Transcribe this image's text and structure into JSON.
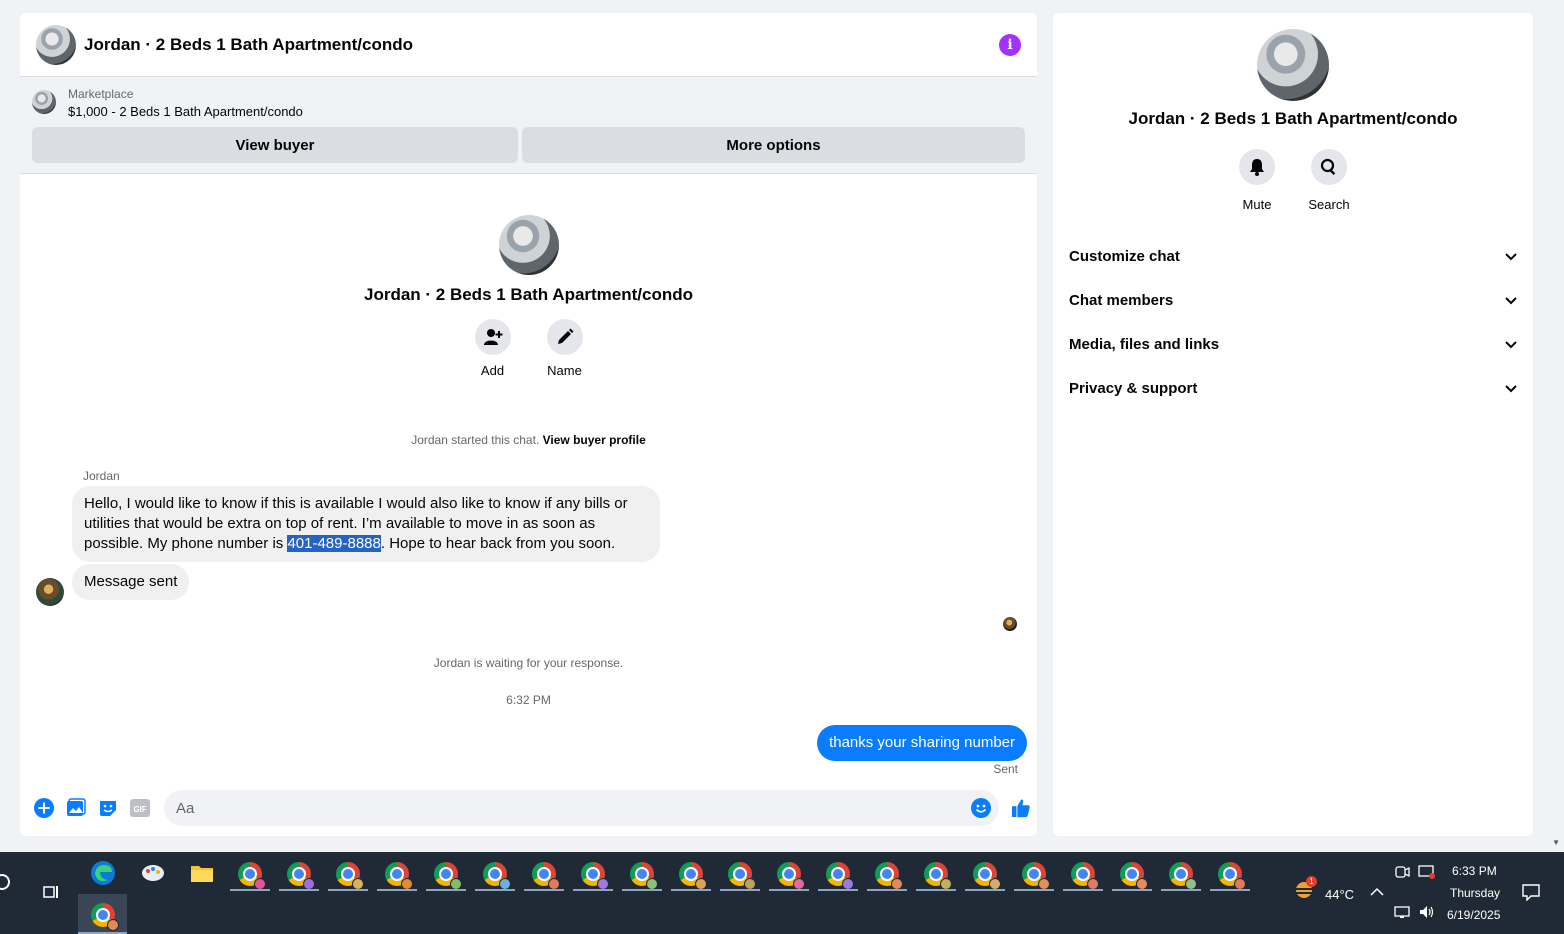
{
  "chat": {
    "title": "Jordan · 2 Beds 1 Bath Apartment/condo",
    "marketplace_label": "Marketplace",
    "marketplace_listing": "$1,000 - 2 Beds 1 Bath Apartment/condo",
    "view_buyer_label": "View buyer",
    "more_options_label": "More options",
    "profile_name": "Jordan · 2 Beds 1 Bath Apartment/condo",
    "add_label": "Add",
    "name_label": "Name",
    "started_text": "Jordan started this chat.",
    "view_buyer_profile_link": "View buyer profile",
    "sender_name": "Jordan",
    "message1_before": "Hello, I would like to know if this is available I would also like to know if any bills or utilities that would be extra on top of rent. I’m available to move in as soon as possible. My phone number is ",
    "message1_phone": "401-489-8888",
    "message1_after": ". Hope to hear back from you soon.",
    "message2": "Message sent",
    "waiting_text": "Jordan is waiting for your response.",
    "timestamp": "6:32 PM",
    "outgoing_message": "thanks your sharing number",
    "sent_status": "Sent",
    "composer_placeholder": "Aa",
    "gif_label": "GIF"
  },
  "side": {
    "name": "Jordan · 2 Beds 1 Bath Apartment/condo",
    "mute_label": "Mute",
    "search_label": "Search",
    "menu": [
      {
        "label": "Customize chat"
      },
      {
        "label": "Chat members"
      },
      {
        "label": "Media, files and links"
      },
      {
        "label": "Privacy & support"
      }
    ]
  },
  "taskbar": {
    "weather": "44°C",
    "weather_badge": "1",
    "time": "6:33 PM",
    "day": "Thursday",
    "date": "6/19/2025"
  },
  "colors": {
    "accent": "#0a7cff",
    "info": "#a033ff",
    "taskbar": "#1f2a36"
  }
}
